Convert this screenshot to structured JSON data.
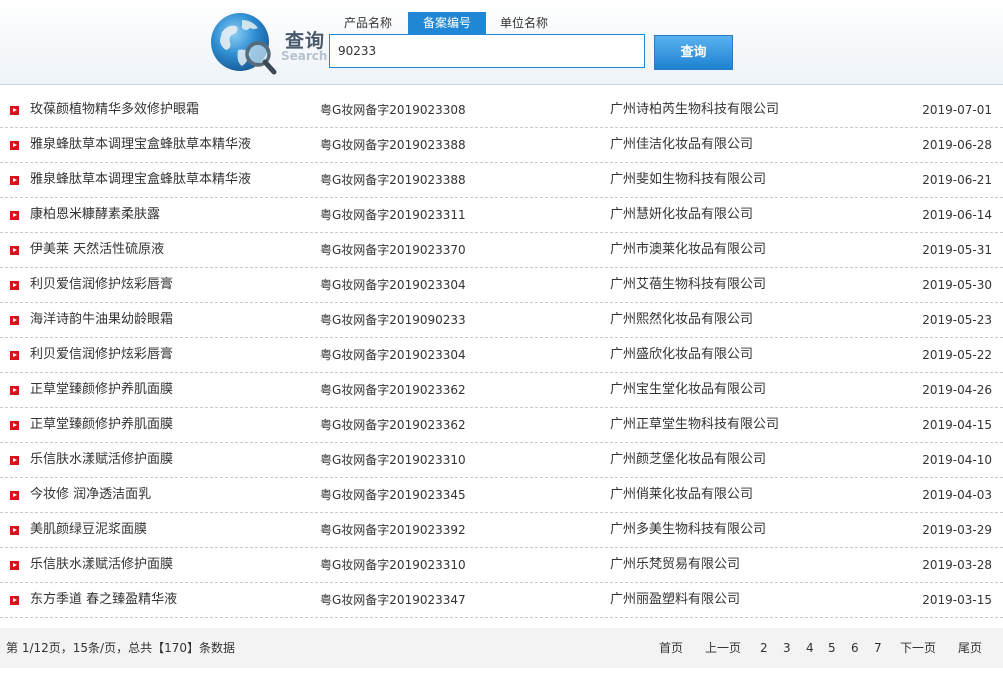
{
  "header": {
    "logo_cn": "查询",
    "logo_en": "Search",
    "tabs": [
      {
        "label": "产品名称"
      },
      {
        "label": "备案编号"
      },
      {
        "label": "单位名称"
      }
    ],
    "active_tab": "备案编号",
    "search_value": "90233",
    "search_button": "查询",
    "accent_color": "#1f87d6"
  },
  "rows": [
    {
      "name": "玫葆颜植物精华多效修护眼霜",
      "code": "粤G妆网备字2019023308",
      "company": "广州诗柏芮生物科技有限公司",
      "date": "2019-07-01"
    },
    {
      "name": "雅泉蜂肽草本调理宝盒蜂肽草本精华液",
      "code": "粤G妆网备字2019023388",
      "company": "广州佳洁化妆品有限公司",
      "date": "2019-06-28"
    },
    {
      "name": "雅泉蜂肽草本调理宝盒蜂肽草本精华液",
      "code": "粤G妆网备字2019023388",
      "company": "广州斐如生物科技有限公司",
      "date": "2019-06-21"
    },
    {
      "name": "康柏恩米糠酵素柔肤露",
      "code": "粤G妆网备字2019023311",
      "company": "广州慧妍化妆品有限公司",
      "date": "2019-06-14"
    },
    {
      "name": "伊美莱 天然活性硫原液",
      "code": "粤G妆网备字2019023370",
      "company": "广州市澳莱化妆品有限公司",
      "date": "2019-05-31"
    },
    {
      "name": "利贝爱信润修护炫彩唇膏",
      "code": "粤G妆网备字2019023304",
      "company": "广州艾蓓生物科技有限公司",
      "date": "2019-05-30"
    },
    {
      "name": "海洋诗韵牛油果幼龄眼霜",
      "code": "粤G妆网备字2019090233",
      "company": "广州熙然化妆品有限公司",
      "date": "2019-05-23"
    },
    {
      "name": "利贝爱信润修护炫彩唇膏",
      "code": "粤G妆网备字2019023304",
      "company": "广州盛欣化妆品有限公司",
      "date": "2019-05-22"
    },
    {
      "name": "正草堂臻颜修护养肌面膜",
      "code": "粤G妆网备字2019023362",
      "company": "广州宝生堂化妆品有限公司",
      "date": "2019-04-26"
    },
    {
      "name": "正草堂臻颜修护养肌面膜",
      "code": "粤G妆网备字2019023362",
      "company": "广州正草堂生物科技有限公司",
      "date": "2019-04-15"
    },
    {
      "name": "乐信肤水漾赋活修护面膜",
      "code": "粤G妆网备字2019023310",
      "company": "广州颜芝堡化妆品有限公司",
      "date": "2019-04-10"
    },
    {
      "name": "今妆修 润净透洁面乳",
      "code": "粤G妆网备字2019023345",
      "company": "广州俏莱化妆品有限公司",
      "date": "2019-04-03"
    },
    {
      "name": "美肌颜绿豆泥浆面膜",
      "code": "粤G妆网备字2019023392",
      "company": "广州多美生物科技有限公司",
      "date": "2019-03-29"
    },
    {
      "name": "乐信肤水漾赋活修护面膜",
      "code": "粤G妆网备字2019023310",
      "company": "广州乐梵贸易有限公司",
      "date": "2019-03-28"
    },
    {
      "name": "东方季道 春之臻盈精华液",
      "code": "粤G妆网备字2019023347",
      "company": "广州丽盈塑料有限公司",
      "date": "2019-03-15"
    }
  ],
  "pagination": {
    "info": "第 1/12页，15条/页，总共【170】条数据",
    "first": "首页",
    "prev": "上一页",
    "pages": [
      "2",
      "3",
      "4",
      "5",
      "6",
      "7"
    ],
    "next": "下一页",
    "last": "尾页"
  }
}
